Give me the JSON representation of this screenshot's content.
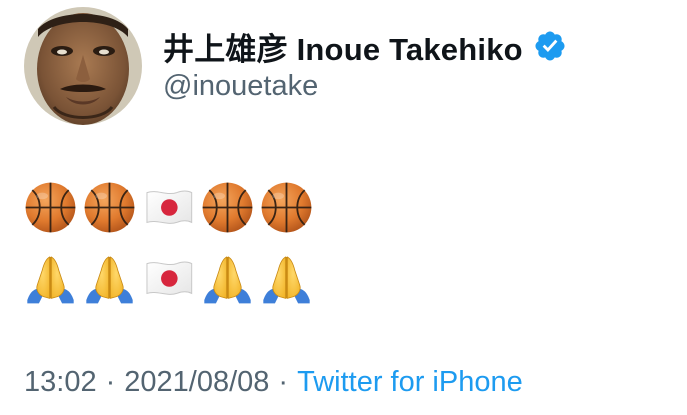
{
  "tweet": {
    "author": {
      "display_name": "井上雄彦 Inoue Takehiko",
      "handle": "@inouetake",
      "verified": true,
      "verified_color": "#1d9bf0",
      "avatar_icon": "portrait-avatar-icon"
    },
    "body": {
      "line1": [
        "basketball-emoji",
        "basketball-emoji",
        "japan-flag-emoji",
        "basketball-emoji",
        "basketball-emoji"
      ],
      "line2": [
        "folded-hands-emoji",
        "folded-hands-emoji",
        "japan-flag-emoji",
        "folded-hands-emoji",
        "folded-hands-emoji"
      ]
    },
    "meta": {
      "time": "13:02",
      "separator": "·",
      "date": "2021/08/08",
      "source": "Twitter for iPhone",
      "link_color": "#1d9bf0",
      "muted_color": "#536471"
    }
  }
}
